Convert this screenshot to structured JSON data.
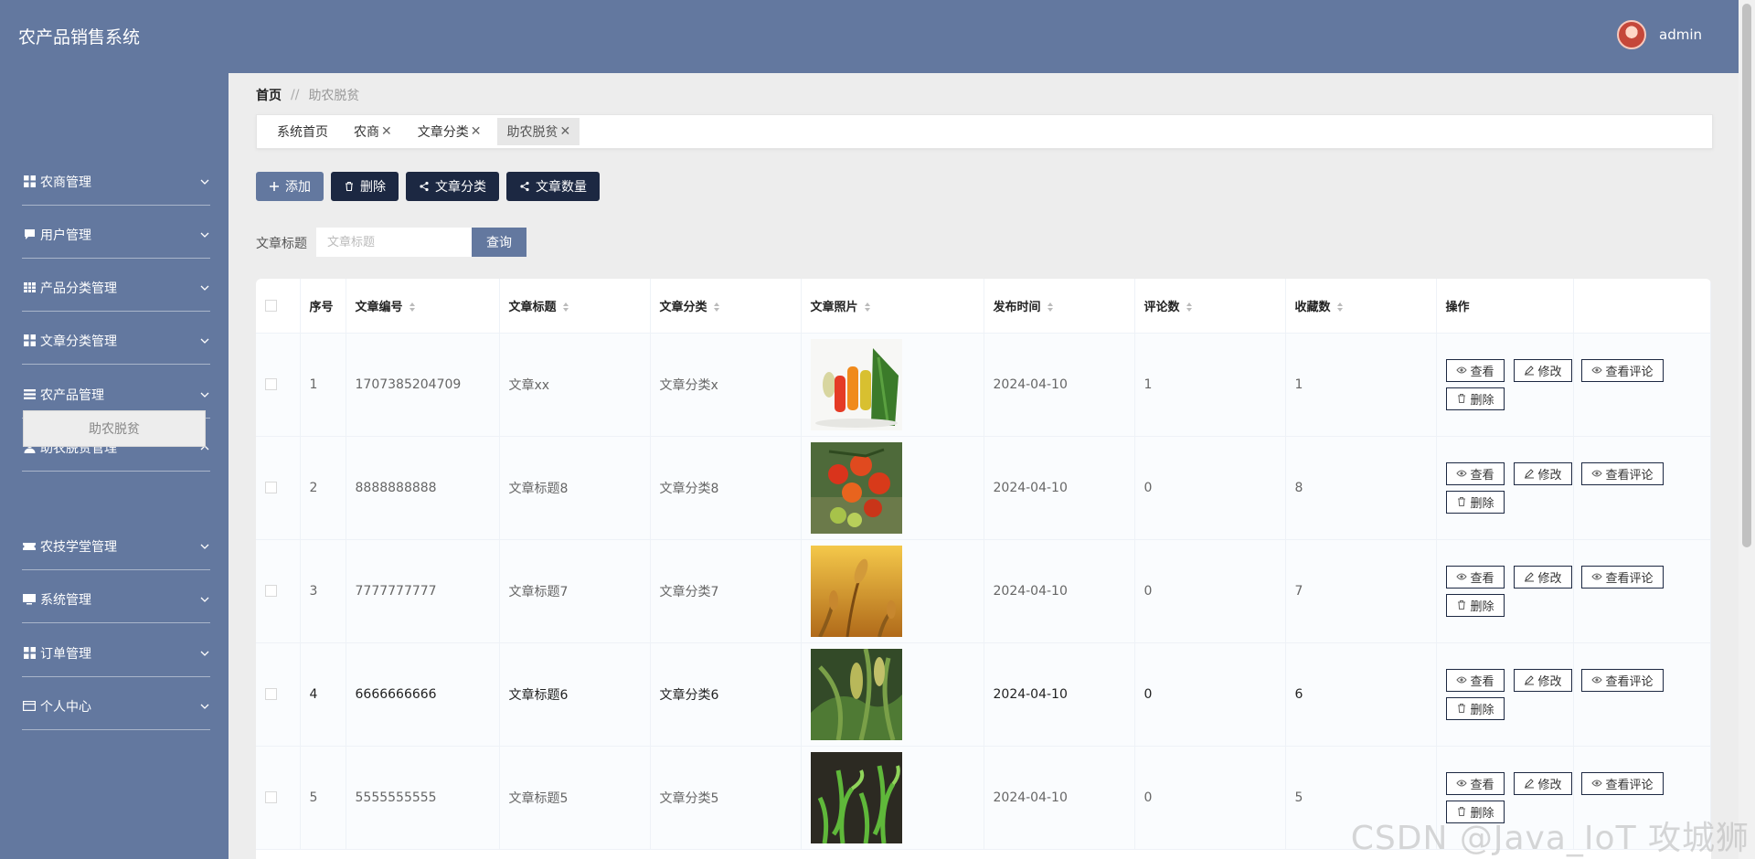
{
  "header": {
    "title": "农产品销售系统",
    "user_name": "admin"
  },
  "sidebar": {
    "items": [
      {
        "label": "农商管理",
        "icon": "grid-icon",
        "expanded": false
      },
      {
        "label": "用户管理",
        "icon": "chat-icon",
        "expanded": false
      },
      {
        "label": "产品分类管理",
        "icon": "table-icon",
        "expanded": false
      },
      {
        "label": "文章分类管理",
        "icon": "grid-icon",
        "expanded": false
      },
      {
        "label": "农产品管理",
        "icon": "list-icon",
        "expanded": false
      },
      {
        "label": "助农脱贫管理",
        "icon": "user-icon",
        "expanded": true
      },
      {
        "label": "农技学堂管理",
        "icon": "ticket-icon",
        "expanded": false
      },
      {
        "label": "系统管理",
        "icon": "monitor-icon",
        "expanded": false
      },
      {
        "label": "订单管理",
        "icon": "grid-icon",
        "expanded": false
      },
      {
        "label": "个人中心",
        "icon": "card-icon",
        "expanded": false
      }
    ],
    "submenu": {
      "label": "助农脱贫"
    }
  },
  "breadcrumb": {
    "home": "首页",
    "separator": "//",
    "current": "助农脱贫"
  },
  "tabs": [
    {
      "label": "系统首页",
      "closable": false,
      "active": false
    },
    {
      "label": "农商",
      "closable": true,
      "active": false
    },
    {
      "label": "文章分类",
      "closable": true,
      "active": false
    },
    {
      "label": "助农脱贫",
      "closable": true,
      "active": true
    }
  ],
  "actions": {
    "add": "添加",
    "delete": "删除",
    "category": "文章分类",
    "count": "文章数量"
  },
  "search": {
    "label": "文章标题",
    "placeholder": "文章标题",
    "button": "查询"
  },
  "table": {
    "columns": [
      "序号",
      "文章编号",
      "文章标题",
      "文章分类",
      "文章照片",
      "发布时间",
      "评论数",
      "收藏数",
      "操作"
    ],
    "op_labels": {
      "view": "查看",
      "edit": "修改",
      "comments": "查看评论",
      "delete": "删除"
    },
    "rows": [
      {
        "index": "1",
        "code": "1707385204709",
        "title": "文章xx",
        "category": "文章分类x",
        "photo": "vegetables",
        "date": "2024-04-10",
        "comments": "1",
        "favorites": "1"
      },
      {
        "index": "2",
        "code": "8888888888",
        "title": "文章标题8",
        "category": "文章分类8",
        "photo": "tomatoes",
        "date": "2024-04-10",
        "comments": "0",
        "favorites": "8"
      },
      {
        "index": "3",
        "code": "7777777777",
        "title": "文章标题7",
        "category": "文章分类7",
        "photo": "wheat",
        "date": "2024-04-10",
        "comments": "0",
        "favorites": "7"
      },
      {
        "index": "4",
        "code": "6666666666",
        "title": "文章标题6",
        "category": "文章分类6",
        "photo": "millet",
        "date": "2024-04-10",
        "comments": "0",
        "favorites": "6"
      },
      {
        "index": "5",
        "code": "5555555555",
        "title": "文章标题5",
        "category": "文章分类5",
        "photo": "seedlings",
        "date": "2024-04-10",
        "comments": "0",
        "favorites": "5"
      }
    ]
  },
  "watermark": "CSDN @Java_IoT 攻城狮",
  "colors": {
    "primary": "#63789f",
    "dark_button": "#1c2842",
    "background": "#ededed"
  }
}
